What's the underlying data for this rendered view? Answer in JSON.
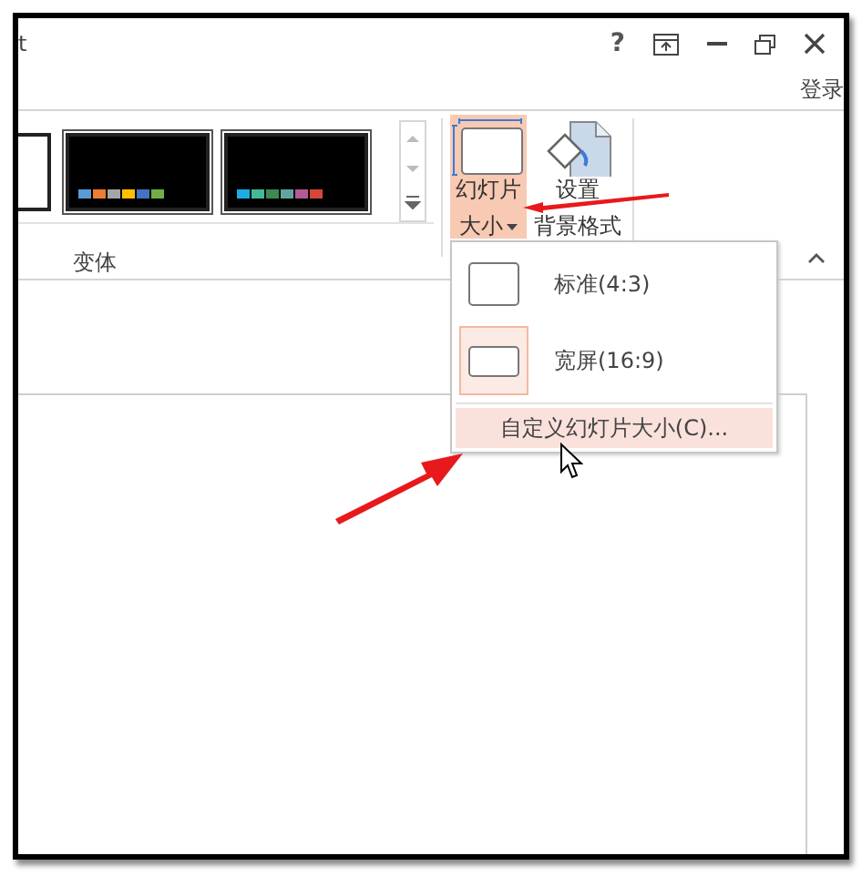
{
  "window": {
    "title_fragment": "t",
    "help": "?"
  },
  "account": {
    "sign_in": "登录"
  },
  "ribbon": {
    "variants": {
      "label": "变体",
      "thumbnails": [
        {
          "kind": "partial"
        },
        {
          "kind": "dark",
          "swatches": [
            {
              "color": "#5b9bd5"
            },
            {
              "color": "#ed7d31"
            },
            {
              "color": "#a5a5a5"
            },
            {
              "color": "#ffc000"
            },
            {
              "color": "#4472c4"
            },
            {
              "color": "#70ad47"
            }
          ]
        },
        {
          "kind": "dark",
          "swatches": [
            {
              "color": "#1cade4"
            },
            {
              "color": "#42ba97"
            },
            {
              "color": "#3e8853"
            },
            {
              "color": "#62a39f"
            },
            {
              "color": "#b45a96"
            },
            {
              "color": "#d6463a"
            }
          ]
        }
      ]
    },
    "buttons": [
      {
        "kind": "slide-size",
        "lines": [
          "幻灯片",
          "大小"
        ],
        "dropdown": true,
        "active": true
      },
      {
        "kind": "background",
        "lines": [
          "设置",
          "背景格式"
        ],
        "dropdown": false,
        "active": false
      }
    ]
  },
  "menu": {
    "options": [
      {
        "label": "标准(4:3)",
        "kind": "standard",
        "selected": false
      },
      {
        "label": "宽屏(16:9)",
        "kind": "wide",
        "selected": true
      }
    ],
    "custom": {
      "label": "自定义幻灯片大小(C)...",
      "highlighted": true
    }
  }
}
